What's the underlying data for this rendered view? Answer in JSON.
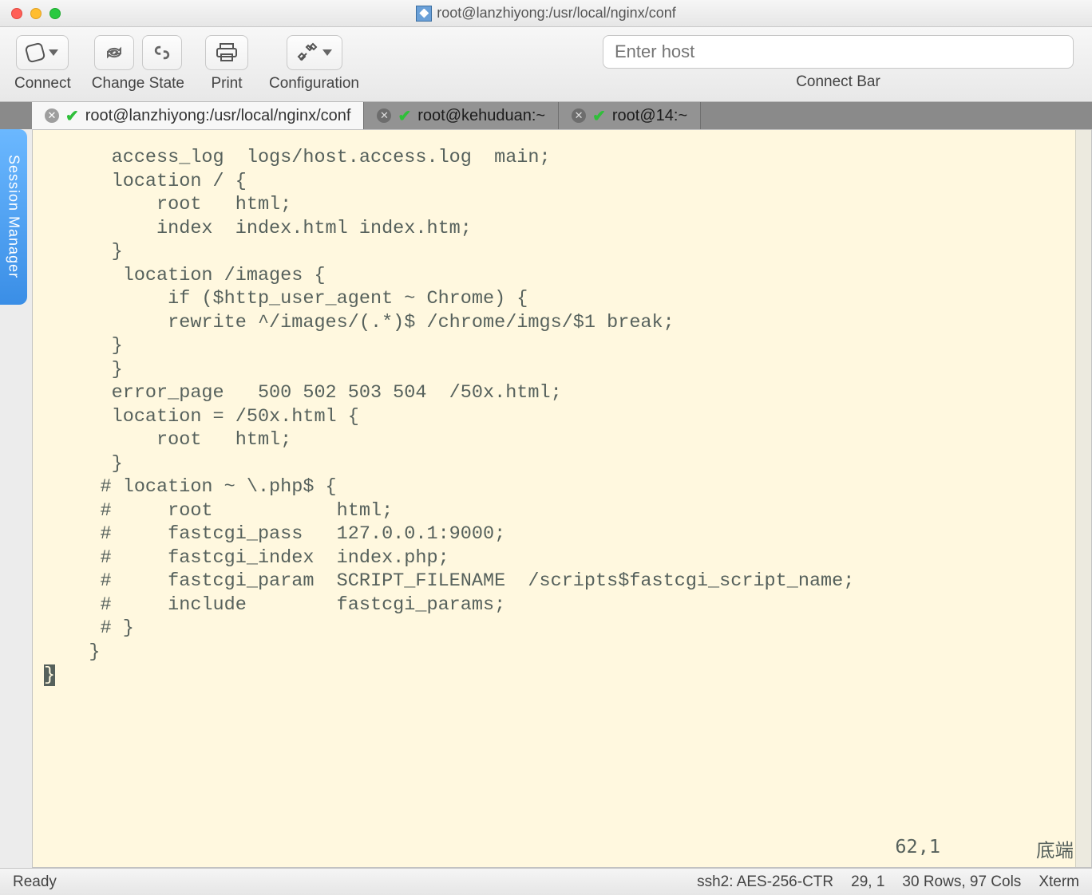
{
  "window": {
    "title": "root@lanzhiyong:/usr/local/nginx/conf"
  },
  "toolbar": {
    "connect": "Connect",
    "change_state": "Change State",
    "print": "Print",
    "configuration": "Configuration",
    "connect_bar": "Connect Bar",
    "host_placeholder": "Enter host"
  },
  "side_tab": {
    "label": "Session Manager"
  },
  "tabs": [
    {
      "label": "root@lanzhiyong:/usr/local/nginx/conf",
      "active": true
    },
    {
      "label": "root@kehuduan:~",
      "active": false
    },
    {
      "label": "root@14:~",
      "active": false
    }
  ],
  "terminal": {
    "lines": [
      "",
      "      access_log  logs/host.access.log  main;",
      "",
      "      location / {",
      "          root   html;",
      "          index  index.html index.htm;",
      "      }",
      "",
      "       location /images {",
      "           if ($http_user_agent ~ Chrome) {",
      "           rewrite ^/images/(.*)$ /chrome/imgs/$1 break;",
      "      }",
      "",
      "      }",
      "",
      "      error_page   500 502 503 504  /50x.html;",
      "      location = /50x.html {",
      "          root   html;",
      "      }",
      "",
      "     # location ~ \\.php$ {",
      "     #     root           html;",
      "     #     fastcgi_pass   127.0.0.1:9000;",
      "     #     fastcgi_index  index.php;",
      "     #     fastcgi_param  SCRIPT_FILENAME  /scripts$fastcgi_script_name;",
      "     #     include        fastcgi_params;",
      "     # }",
      "    }"
    ],
    "cursor_line": "}",
    "vim_pos": "62,1",
    "vim_scroll": "底端"
  },
  "status": {
    "ready": "Ready",
    "conn": "ssh2: AES-256-CTR",
    "pos": "29, 1",
    "size": "30 Rows, 97 Cols",
    "term": "Xterm"
  }
}
